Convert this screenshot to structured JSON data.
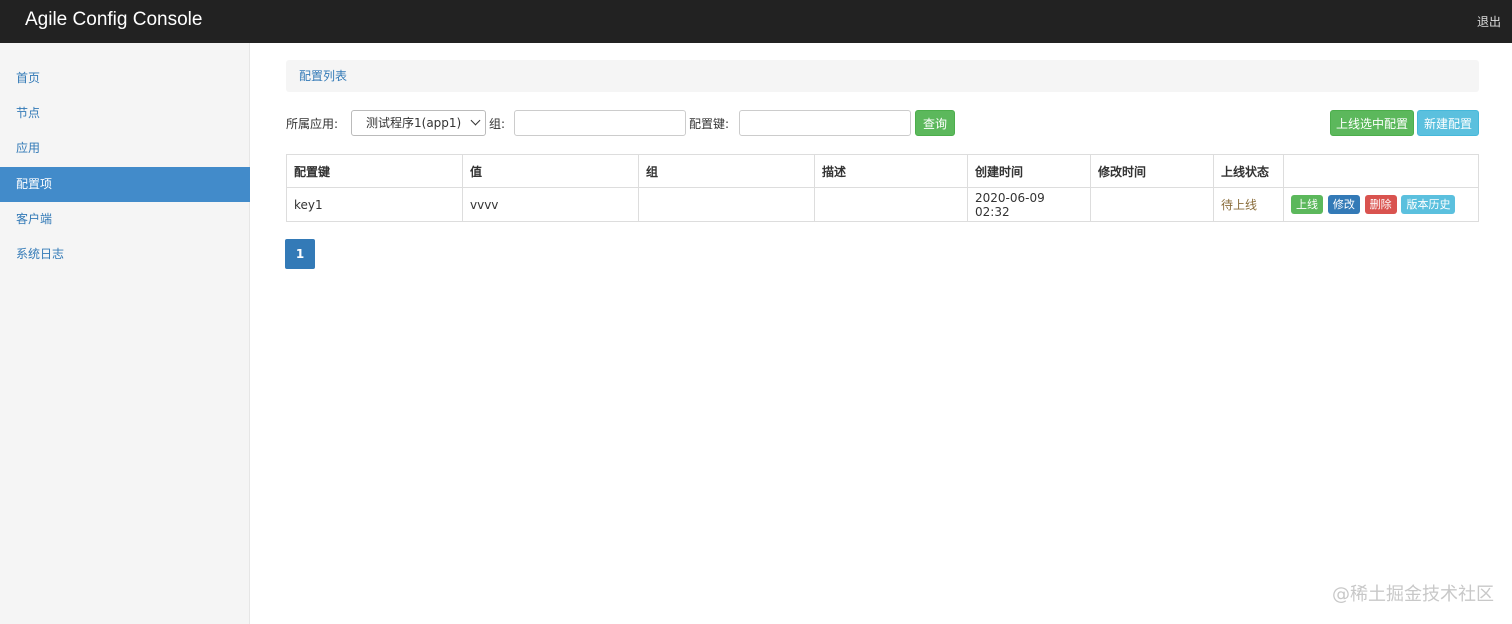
{
  "header": {
    "brand": "Agile Config Console",
    "logout": "退出"
  },
  "sidebar": {
    "items": [
      {
        "label": "首页"
      },
      {
        "label": "节点"
      },
      {
        "label": "应用"
      },
      {
        "label": "配置项"
      },
      {
        "label": "客户端"
      },
      {
        "label": "系统日志"
      }
    ],
    "active": "配置项"
  },
  "breadcrumb": "配置列表",
  "filters": {
    "app_label": "所属应用:",
    "app_selected": "测试程序1(app1)",
    "group_label": "组:",
    "group_value": "",
    "key_label": "配置键:",
    "key_value": "",
    "query_button": "查询"
  },
  "actions": {
    "publish_selected": "上线选中配置",
    "new_config": "新建配置"
  },
  "table": {
    "columns": [
      "配置键",
      "值",
      "组",
      "描述",
      "创建时间",
      "修改时间",
      "上线状态",
      ""
    ],
    "rows": [
      {
        "key": "key1",
        "value": "vvvv",
        "group": "",
        "description": "",
        "created": "2020-06-09 02:32",
        "modified": "",
        "status": "待上线",
        "buttons": {
          "online": "上线",
          "edit": "修改",
          "delete": "删除",
          "history": "版本历史"
        }
      }
    ]
  },
  "pagination": {
    "current": "1"
  },
  "watermark": "@稀土掘金技术社区"
}
